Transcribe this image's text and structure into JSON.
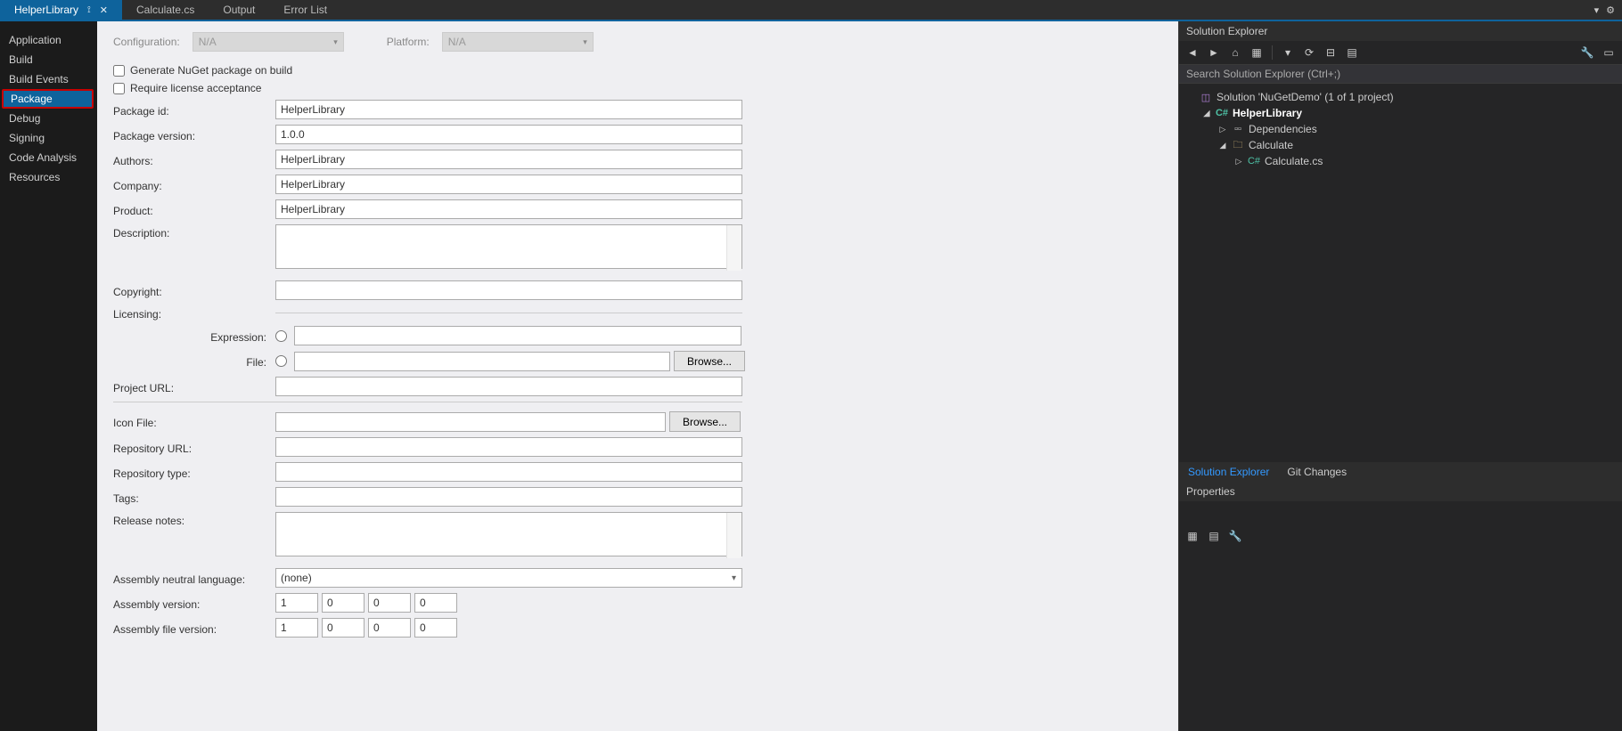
{
  "tabs": {
    "active": "HelperLibrary",
    "inactive": [
      "Calculate.cs",
      "Output",
      "Error List"
    ]
  },
  "side": {
    "items": [
      "Application",
      "Build",
      "Build Events",
      "Package",
      "Debug",
      "Signing",
      "Code Analysis",
      "Resources"
    ],
    "selected": "Package"
  },
  "cfg": {
    "configuration_label": "Configuration:",
    "configuration_value": "N/A",
    "platform_label": "Platform:",
    "platform_value": "N/A"
  },
  "chk": {
    "genNuget": "Generate NuGet package on build",
    "reqLicense": "Require license acceptance"
  },
  "f": {
    "packageId": {
      "label": "Package id:",
      "value": "HelperLibrary"
    },
    "packageVersion": {
      "label": "Package version:",
      "value": "1.0.0"
    },
    "authors": {
      "label": "Authors:",
      "value": "HelperLibrary"
    },
    "company": {
      "label": "Company:",
      "value": "HelperLibrary"
    },
    "product": {
      "label": "Product:",
      "value": "HelperLibrary"
    },
    "description": {
      "label": "Description:",
      "value": ""
    },
    "copyright": {
      "label": "Copyright:",
      "value": ""
    },
    "licensing": {
      "label": "Licensing:"
    },
    "expression": {
      "label": "Expression:",
      "value": ""
    },
    "file": {
      "label": "File:",
      "value": "",
      "browse": "Browse..."
    },
    "projectUrl": {
      "label": "Project URL:",
      "value": ""
    },
    "iconFile": {
      "label": "Icon File:",
      "value": "",
      "browse": "Browse..."
    },
    "repoUrl": {
      "label": "Repository URL:",
      "value": ""
    },
    "repoType": {
      "label": "Repository type:",
      "value": ""
    },
    "tags": {
      "label": "Tags:",
      "value": ""
    },
    "releaseNotes": {
      "label": "Release notes:",
      "value": ""
    },
    "asmNeutral": {
      "label": "Assembly neutral language:",
      "value": "(none)"
    },
    "asmVersion": {
      "label": "Assembly version:",
      "values": [
        "1",
        "0",
        "0",
        "0"
      ]
    },
    "asmFileVersion": {
      "label": "Assembly file version:",
      "values": [
        "1",
        "0",
        "0",
        "0"
      ]
    }
  },
  "solutionExplorer": {
    "title": "Solution Explorer",
    "searchPlaceholder": "Search Solution Explorer (Ctrl+;)",
    "solution": "Solution 'NuGetDemo' (1 of 1 project)",
    "project": "HelperLibrary",
    "dependencies": "Dependencies",
    "folder": "Calculate",
    "file": "Calculate.cs",
    "tabs": [
      "Solution Explorer",
      "Git Changes"
    ]
  },
  "properties": {
    "title": "Properties"
  }
}
